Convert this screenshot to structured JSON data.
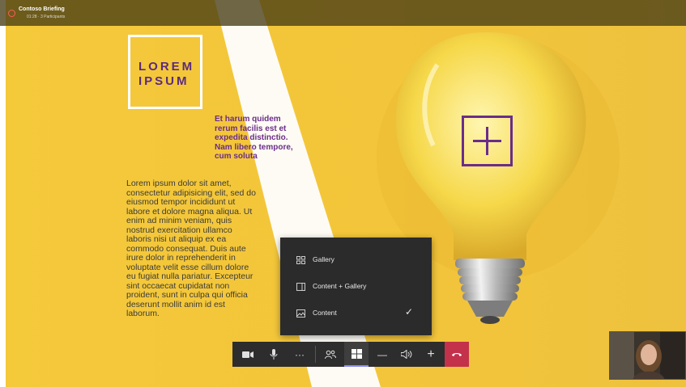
{
  "meeting": {
    "title": "Contoso Briefing",
    "subtitle": "01:28 · 3 Participants"
  },
  "slide": {
    "logo_text": "LOREM\nIPSUM",
    "highlight_text": "Et harum quidem\nrerum facilis est et\nexpedita distinctio.\nNam libero tempore,\ncum soluta",
    "body_text": "Lorem ipsum dolor sit amet,\nconsectetur adipisicing elit, sed do\neiusmod tempor incididunt ut\nlabore et dolore magna aliqua. Ut\nenim ad minim veniam, quis\nnostrud exercitation ullamco\nlaboris nisi ut aliquip ex ea\ncommodo consequat. Duis aute\nirure dolor in reprehenderit in\nvoluptate velit esse cillum dolore\neu fugiat nulla pariatur. Excepteur\nsint occaecat cupidatat non\nproident, sunt in culpa qui officia\ndeserunt mollit anim id est\nlaborum.",
    "colors": {
      "yellow": "#f3c53a",
      "purple": "#6a2d8a"
    }
  },
  "layout_menu": {
    "items": [
      {
        "label": "Gallery",
        "icon": "grid-icon",
        "selected": false
      },
      {
        "label": "Content + Gallery",
        "icon": "split-panel-icon",
        "selected": false
      },
      {
        "label": "Content",
        "icon": "image-icon",
        "selected": true
      }
    ]
  },
  "toolbar": {
    "buttons": [
      {
        "name": "camera",
        "icon": "video-camera-icon"
      },
      {
        "name": "microphone",
        "icon": "microphone-icon"
      },
      {
        "name": "more",
        "icon": "more-icon",
        "glyph": "···"
      },
      {
        "name": "participants",
        "icon": "people-icon"
      },
      {
        "name": "layout",
        "icon": "layout-icon",
        "active": true
      },
      {
        "name": "zoom-out",
        "icon": "minus-icon",
        "glyph": "—"
      },
      {
        "name": "volume",
        "icon": "speaker-icon"
      },
      {
        "name": "zoom-in",
        "icon": "plus-icon",
        "glyph": "+"
      },
      {
        "name": "hang-up",
        "icon": "phone-hangup-icon"
      }
    ],
    "hangup_color": "#c4314b"
  }
}
